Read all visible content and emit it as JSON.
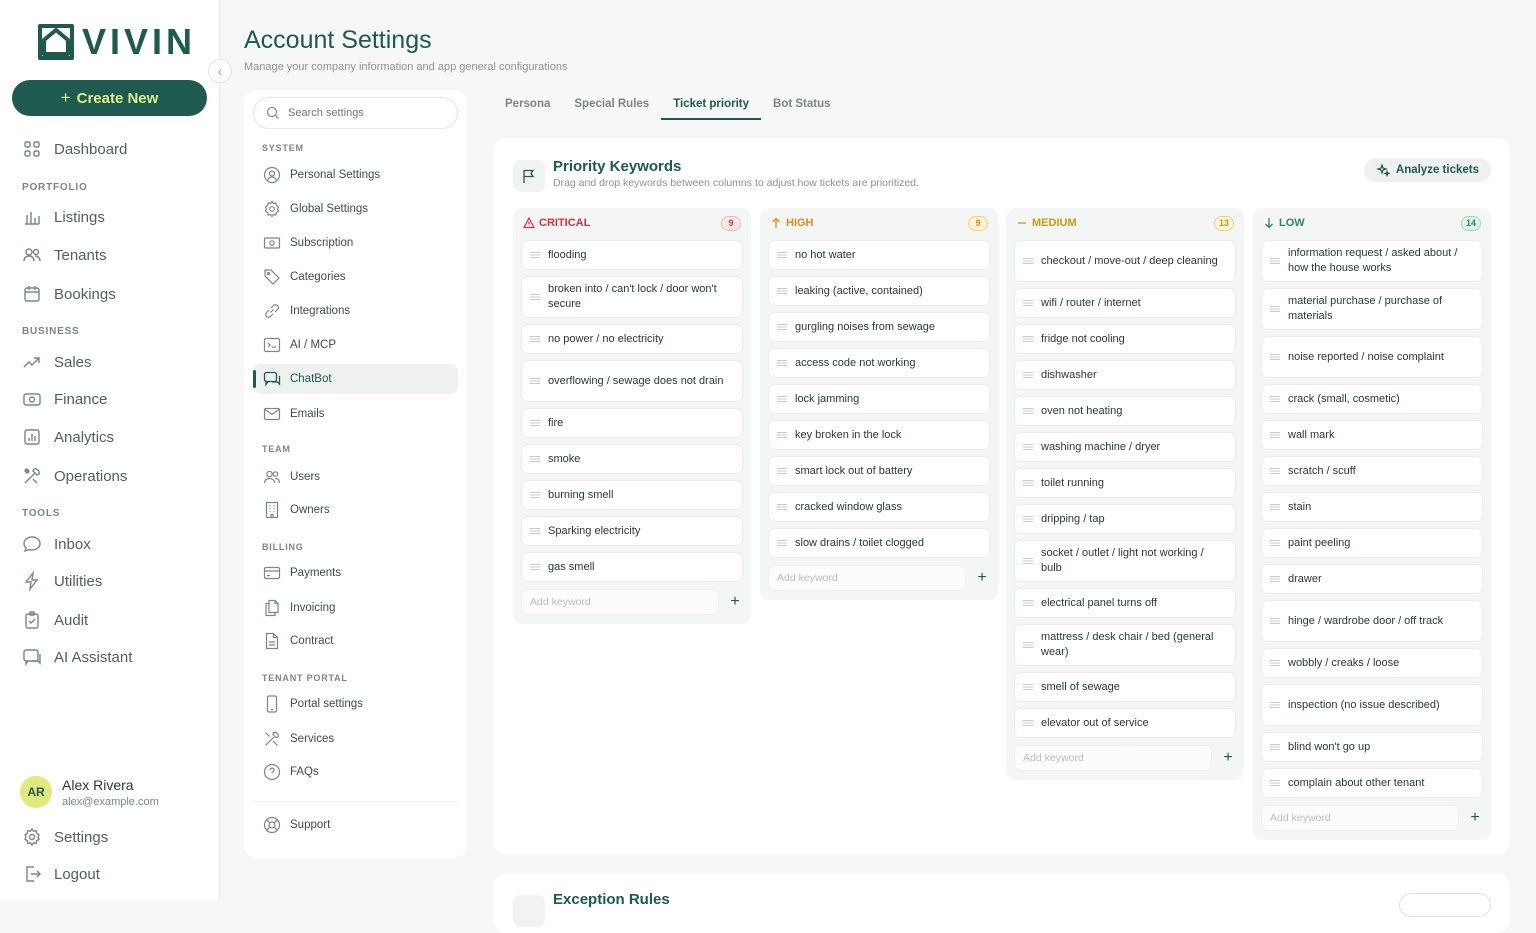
{
  "brand": {
    "name": "VIVIN"
  },
  "sidebar": {
    "create_label": "Create New",
    "sections": {
      "portfolio": "PORTFOLIO",
      "business": "BUSINESS",
      "tools": "TOOLS"
    },
    "items": {
      "dashboard": "Dashboard",
      "listings": "Listings",
      "tenants": "Tenants",
      "bookings": "Bookings",
      "sales": "Sales",
      "finance": "Finance",
      "analytics": "Analytics",
      "operations": "Operations",
      "inbox": "Inbox",
      "utilities": "Utilities",
      "audit": "Audit",
      "ai_assistant": "AI Assistant"
    },
    "user": {
      "initials": "AR",
      "name": "Alex Rivera",
      "email": "alex@example.com"
    },
    "settings_label": "Settings",
    "logout_label": "Logout"
  },
  "page": {
    "title": "Account Settings",
    "subtitle": "Manage your company information and app general configurations"
  },
  "settings_nav": {
    "search_placeholder": "Search settings",
    "sections": {
      "system": "SYSTEM",
      "team": "TEAM",
      "billing": "BILLING",
      "tenant_portal": "TENANT PORTAL"
    },
    "items": {
      "personal": "Personal Settings",
      "global": "Global Settings",
      "subscription": "Subscription",
      "categories": "Categories",
      "integrations": "Integrations",
      "ai_mcp": "AI / MCP",
      "chatbot": "ChatBot",
      "emails": "Emails",
      "users": "Users",
      "owners": "Owners",
      "payments": "Payments",
      "invoicing": "Invoicing",
      "contract": "Contract",
      "portal_settings": "Portal settings",
      "services": "Services",
      "faqs": "FAQs",
      "support": "Support"
    }
  },
  "tabs": [
    "Persona",
    "Special Rules",
    "Ticket priority",
    "Bot Status"
  ],
  "active_tab": "Ticket priority",
  "priority": {
    "title": "Priority Keywords",
    "subtitle": "Drag and drop keywords between columns to adjust how tickets are prioritized.",
    "analyze_label": "Analyze tickets",
    "add_placeholder": "Add keyword",
    "columns": [
      {
        "label": "CRITICAL",
        "count": "9",
        "color": "#d4343a",
        "count_bg": "#fde8e8",
        "count_border": "#f3b6b8",
        "keywords": [
          "flooding",
          "broken into / can't lock / door won't secure",
          "no power / no electricity",
          "overflowing / sewage does not drain",
          "fire",
          "smoke",
          "burning smell",
          "Sparking electricity",
          "gas smell"
        ]
      },
      {
        "label": "HIGH",
        "count": "9",
        "color": "#e08a1e",
        "count_bg": "#fff4d6",
        "count_border": "#f3d27a",
        "keywords": [
          "no hot water",
          "leaking (active, contained)",
          "gurgling noises from sewage",
          "access code not working",
          "lock jamming",
          "key broken in the lock",
          "smart lock out of battery",
          "cracked window glass",
          "slow drains / toilet clogged"
        ]
      },
      {
        "label": "MEDIUM",
        "count": "13",
        "color": "#c79a12",
        "count_bg": "#fdf6d8",
        "count_border": "#ead27a",
        "keywords": [
          "checkout / move-out / deep cleaning",
          "wifi / router / internet",
          "fridge not cooling",
          "dishwasher",
          "oven not heating",
          "washing machine / dryer",
          "toilet running",
          "dripping / tap",
          "socket / outlet / light not working / bulb",
          "electrical panel turns off",
          "mattress / desk chair / bed (general wear)",
          "smell of sewage",
          "elevator out of service"
        ]
      },
      {
        "label": "LOW",
        "count": "14",
        "color": "#2e8b57",
        "count_bg": "#e3f4e8",
        "count_border": "#9fd5b0",
        "keywords": [
          "information request / asked about / how the house works",
          "material purchase / purchase of materials",
          "noise reported / noise complaint",
          "crack (small, cosmetic)",
          "wall mark",
          "scratch / scuff",
          "stain",
          "paint peeling",
          "drawer",
          "hinge / wardrobe door / off track",
          "wobbly / creaks / loose",
          "inspection (no issue described)",
          "blind won't go up",
          "complain about other tenant"
        ]
      }
    ]
  },
  "exception": {
    "title": "Exception Rules"
  }
}
